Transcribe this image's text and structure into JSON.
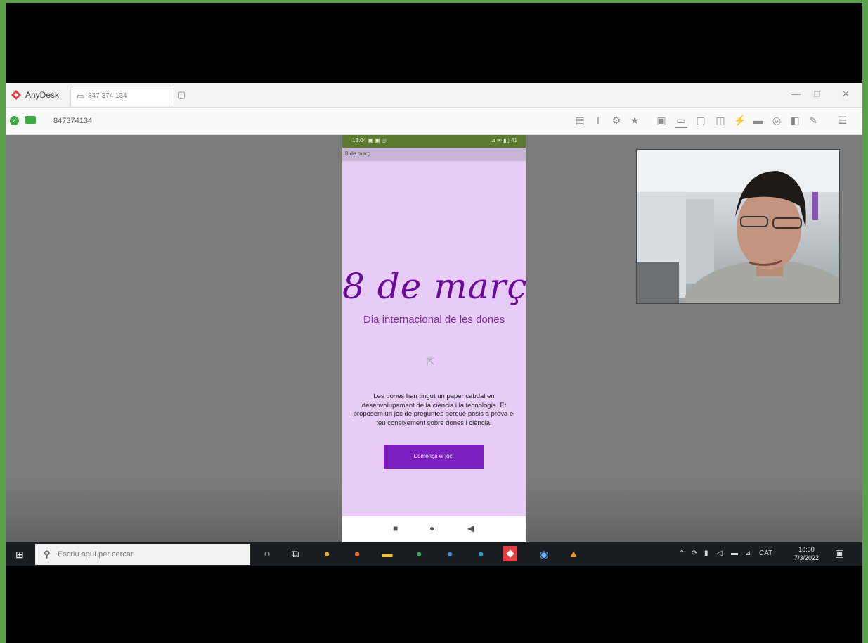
{
  "anydesk": {
    "app_name": "AnyDesk",
    "tab_label": "847 374 134",
    "address_id": "847374134",
    "window_controls": [
      "—",
      "□",
      "✕"
    ]
  },
  "phone": {
    "status_time": "13:04 ▣ ▣ ◎",
    "status_right": "⊿ ✉ ▮▯ 41",
    "appbar_title": "8 de març",
    "title": "8 de març",
    "subtitle": "Dia internacional de les dones",
    "description": "Les dones han tingut un paper cabdal en desenvolupament de la ciència i la tecnologia. Et proposem un joc de preguntes perquè posis a prova el teu coneixement sobre dones i ciència.",
    "start_button": "Comença el joc!",
    "nav": [
      "■",
      "●",
      "◀"
    ]
  },
  "taskbar": {
    "search_placeholder": "Escriu aquí per cercar",
    "tray_lang": "CAT",
    "clock_time": "18:50",
    "clock_date": "7/3/2022"
  },
  "colors": {
    "phone_bg": "#e6ccf7",
    "title_color": "#6a0a9b",
    "button_bg": "#7b1fc1",
    "statusbar": "#5c7a2f",
    "border": "#5aa04a"
  }
}
